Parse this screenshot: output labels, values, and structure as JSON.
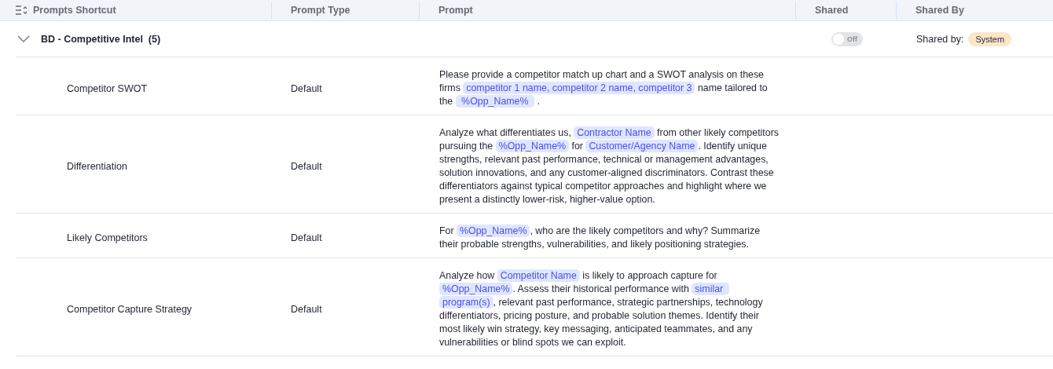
{
  "columns": [
    {
      "label": "Prompts Shortcut"
    },
    {
      "label": "Prompt Type"
    },
    {
      "label": "Prompt"
    },
    {
      "label": "Shared"
    },
    {
      "label": "Shared By"
    }
  ],
  "group": {
    "title": "BD - Competitive Intel",
    "count": "(5)",
    "expanded": true,
    "shared": {
      "on": false,
      "label": "Off"
    },
    "shared_by_label": "Shared by:",
    "shared_by": "System"
  },
  "rows": [
    {
      "shortcut": "Competitor SWOT",
      "type": "Default",
      "prompt": [
        {
          "kind": "text",
          "text": "Please provide a competitor match up chart and a SWOT analysis on these firms "
        },
        {
          "kind": "token",
          "text": "competitor 1 name, competitor 2 name, competitor 3"
        },
        {
          "kind": "text",
          "text": " name tailored to the "
        },
        {
          "kind": "token",
          "text": " %Opp_Name% "
        },
        {
          "kind": "text",
          "text": " ."
        }
      ]
    },
    {
      "shortcut": "Differentiation",
      "type": "Default",
      "prompt": [
        {
          "kind": "text",
          "text": "Analyze what differentiates us, "
        },
        {
          "kind": "token",
          "text": "Contractor Name"
        },
        {
          "kind": "text",
          "text": " from other likely competitors pursuing the "
        },
        {
          "kind": "token",
          "text": "%Opp_Name%"
        },
        {
          "kind": "text",
          "text": " for "
        },
        {
          "kind": "token",
          "text": "Customer/Agency Name"
        },
        {
          "kind": "text",
          "text": ". Identify unique strengths, relevant past performance, technical or management advantages, solution innovations, and any customer-aligned discriminators. Contrast these differentiators against typical competitor approaches and highlight where we present a distinctly lower-risk, higher-value option."
        }
      ]
    },
    {
      "shortcut": "Likely Competitors",
      "type": "Default",
      "prompt": [
        {
          "kind": "text",
          "text": "For "
        },
        {
          "kind": "token",
          "text": "%Opp_Name%"
        },
        {
          "kind": "text",
          "text": ", who are the likely competitors and why? Summarize their probable strengths, vulnerabilities, and likely positioning strategies."
        }
      ]
    },
    {
      "shortcut": "Competitor Capture Strategy",
      "type": "Default",
      "prompt": [
        {
          "kind": "text",
          "text": "Analyze how "
        },
        {
          "kind": "token",
          "text": "Competitor Name"
        },
        {
          "kind": "text",
          "text": " is likely to approach capture for "
        },
        {
          "kind": "token",
          "text": "%Opp_Name%"
        },
        {
          "kind": "text",
          "text": ". Assess their historical performance with "
        },
        {
          "kind": "token",
          "text": "similar program(s)"
        },
        {
          "kind": "text",
          "text": ", relevant past performance, strategic partnerships, technology differentiators, pricing posture, and probable solution themes. Identify their most likely win strategy, key messaging, anticipated teammates, and any vulnerabilities or blind spots we can exploit."
        }
      ]
    }
  ]
}
